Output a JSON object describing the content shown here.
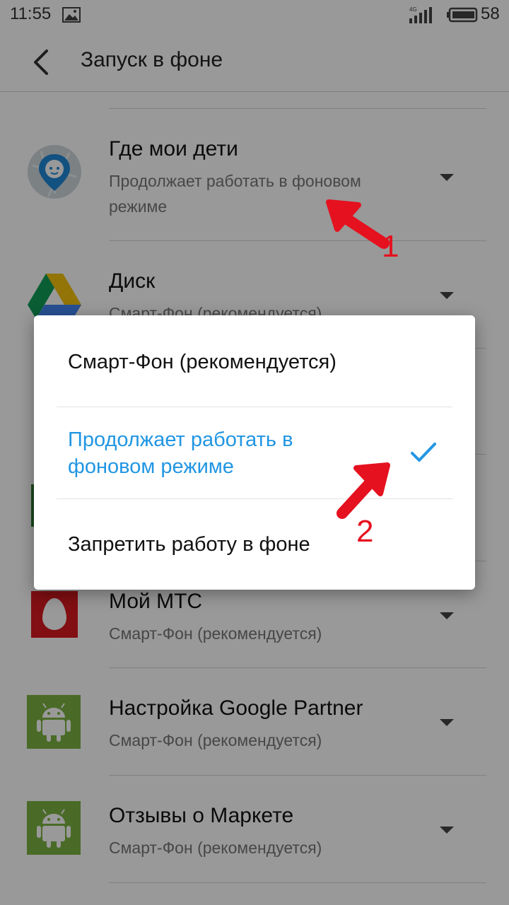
{
  "status_bar": {
    "time": "11:55",
    "battery_level": "58",
    "network": "4G"
  },
  "header": {
    "title": "Запуск в фоне",
    "back_icon": "chevron-left-icon"
  },
  "apps": [
    {
      "name": "Где мои дети",
      "mode": "Продолжает работать в фоновом режиме",
      "icon": "where-are-my-kids-icon"
    },
    {
      "name": "Диск",
      "mode": "Смарт-Фон (рекомендуется)",
      "icon": "google-drive-icon"
    },
    {
      "name": "Мой МТС",
      "mode": "Смарт-Фон (рекомендуется)",
      "icon": "mts-icon"
    },
    {
      "name": "Настройка Google Partner",
      "mode": "Смарт-Фон (рекомендуется)",
      "icon": "android-icon"
    },
    {
      "name": "Отзывы о Маркете",
      "mode": "Смарт-Фон (рекомендуется)",
      "icon": "android-icon"
    }
  ],
  "dialog": {
    "options": [
      {
        "label": "Смарт-Фон (рекомендуется)",
        "selected": false
      },
      {
        "label": "Продолжает работать в фоновом режиме",
        "selected": true
      },
      {
        "label": "Запретить работу в фоне",
        "selected": false
      }
    ]
  },
  "annotations": {
    "arrow_1": "1",
    "arrow_2": "2"
  },
  "colors": {
    "accent": "#2196e3",
    "annotation": "#e5111f",
    "android_green": "#7cb342",
    "mts_red": "#d71920"
  }
}
